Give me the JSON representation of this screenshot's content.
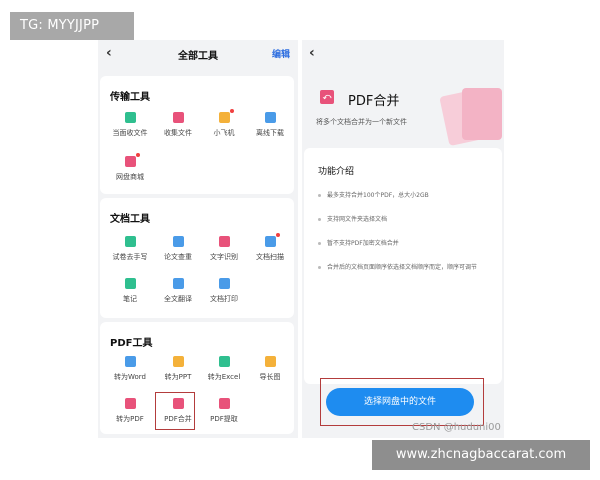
{
  "watermark_top": "TG: MYYJJPP",
  "watermark_bottom": "www.zhcnagbaccarat.com",
  "csdn": "CSDN @huduni00",
  "left": {
    "back": "‹",
    "title": "全部工具",
    "edit": "编辑",
    "sections": [
      {
        "title": "传输工具",
        "tools": [
          {
            "label": "当面收文件",
            "color": "#2fbf8f",
            "dot": false
          },
          {
            "label": "收集文件",
            "color": "#e8527a",
            "dot": false
          },
          {
            "label": "小飞机",
            "color": "#f4b13a",
            "dot": true
          },
          {
            "label": "离线下载",
            "color": "#4a9be8",
            "dot": false
          },
          {
            "label": "网盘商城",
            "color": "#e8527a",
            "dot": true
          }
        ]
      },
      {
        "title": "文档工具",
        "tools": [
          {
            "label": "试卷去手写",
            "color": "#2fbf8f",
            "dot": false
          },
          {
            "label": "论文查重",
            "color": "#4a9be8",
            "dot": false
          },
          {
            "label": "文字识别",
            "color": "#e8527a",
            "dot": false
          },
          {
            "label": "文档扫描",
            "color": "#4a9be8",
            "dot": true
          },
          {
            "label": "笔记",
            "color": "#2fbf8f",
            "dot": false
          },
          {
            "label": "全文翻译",
            "color": "#4a9be8",
            "dot": false
          },
          {
            "label": "文档打印",
            "color": "#4a9be8",
            "dot": false
          }
        ]
      },
      {
        "title": "PDF工具",
        "tools": [
          {
            "label": "转为Word",
            "color": "#4a9be8",
            "dot": false
          },
          {
            "label": "转为PPT",
            "color": "#f4b13a",
            "dot": false
          },
          {
            "label": "转为Excel",
            "color": "#2fbf8f",
            "dot": false
          },
          {
            "label": "导长图",
            "color": "#f4b13a",
            "dot": false
          },
          {
            "label": "转为PDF",
            "color": "#e8527a",
            "dot": false
          },
          {
            "label": "PDF合并",
            "color": "#e8527a",
            "dot": false
          },
          {
            "label": "PDF提取",
            "color": "#e8527a",
            "dot": false
          }
        ]
      }
    ]
  },
  "right": {
    "back": "‹",
    "title": "PDF合并",
    "subtitle": "将多个文档合并为一个新文件",
    "features_title": "功能介绍",
    "features": [
      "最多支持合并100个PDF，总大小2GB",
      "支持网文件夹选择文档",
      "暂不支持PDF加密文档合并",
      "合并后的文档页面顺序依选择文档顺序而定，顺序可调节"
    ],
    "button": "选择网盘中的文件"
  }
}
